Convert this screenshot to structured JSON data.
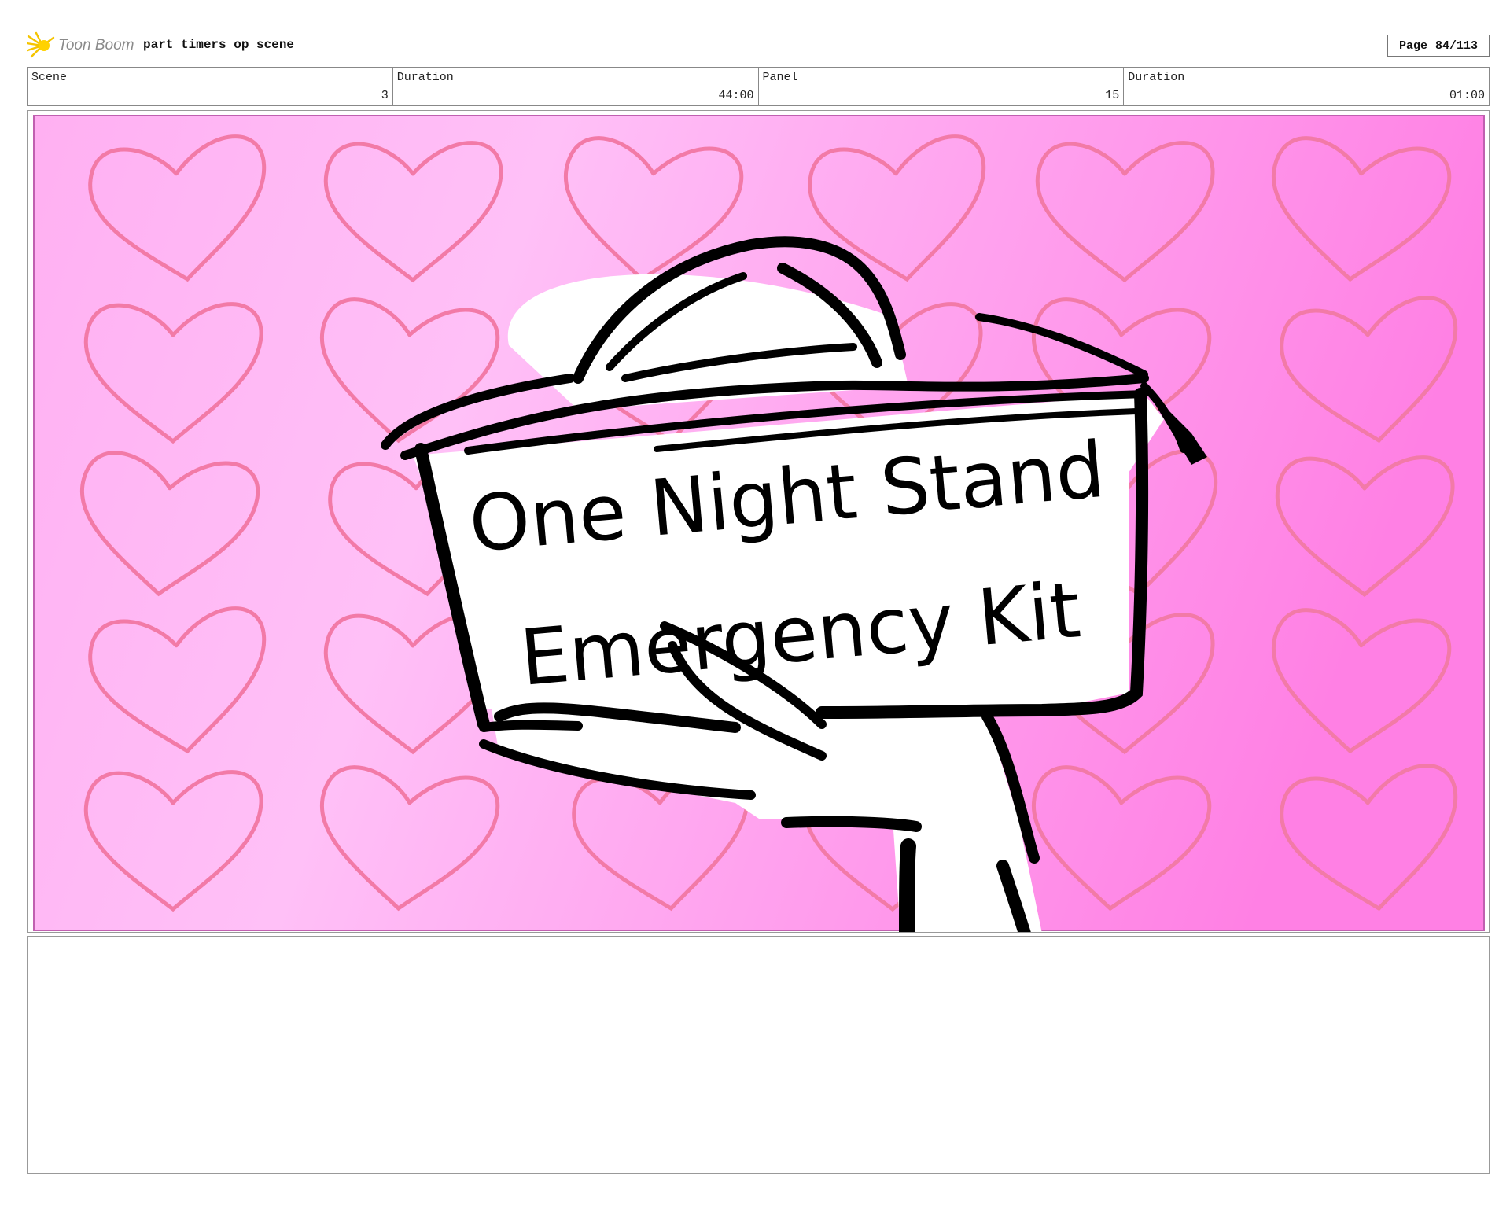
{
  "header": {
    "brand": "Toon Boom",
    "project_title": "part timers op scene",
    "page_label": "Page",
    "page_number": "84/113"
  },
  "info": {
    "scene_label": "Scene",
    "scene_value": "3",
    "scene_duration_label": "Duration",
    "scene_duration_value": "44:00",
    "panel_label": "Panel",
    "panel_value": "15",
    "panel_duration_label": "Duration",
    "panel_duration_value": "01:00"
  },
  "panel_image": {
    "sign_line1": "One Night Stand",
    "sign_line2": "Emergency Kit"
  },
  "colors": {
    "background_light": "#ffc0f5",
    "background_dark": "#ff80e6",
    "heart_stroke": "#f27aa7",
    "ink": "#000000"
  },
  "icons": {
    "logo": "toon-boom-star-icon"
  }
}
